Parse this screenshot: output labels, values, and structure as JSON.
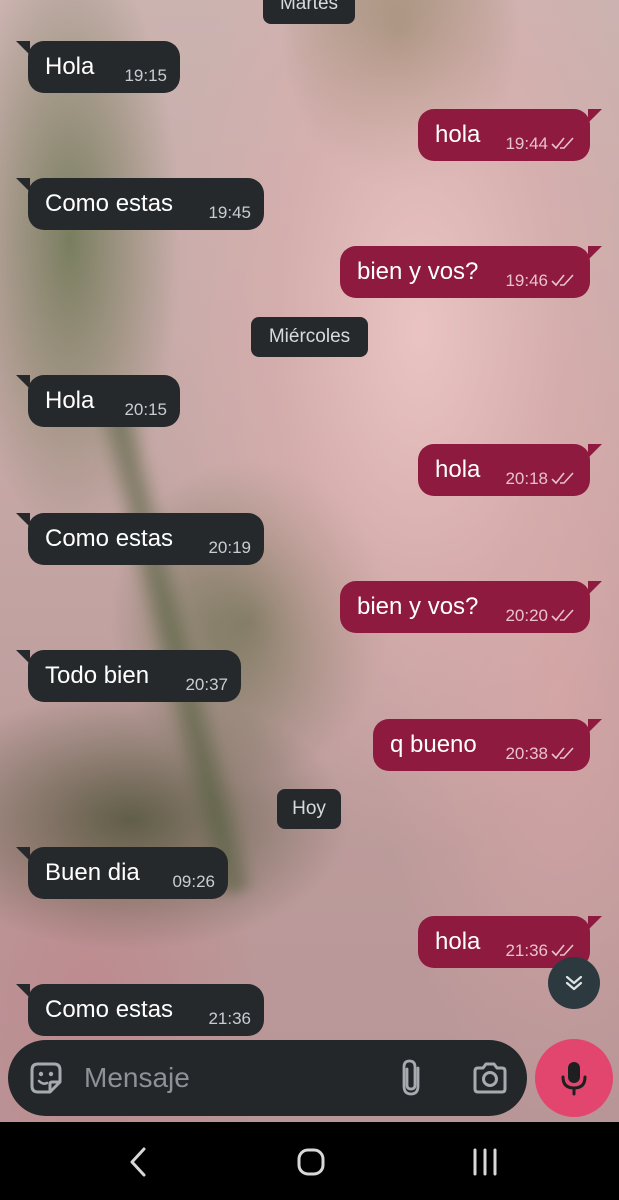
{
  "day_separators": {
    "top": "Martes",
    "second": "Miércoles",
    "third": "Hoy"
  },
  "messages": [
    {
      "dir": "in",
      "text": "Hola",
      "time": "19:15"
    },
    {
      "dir": "out",
      "text": "hola",
      "time": "19:44",
      "status": "read"
    },
    {
      "dir": "in",
      "text": "Como estas",
      "time": "19:45"
    },
    {
      "dir": "out",
      "text": "bien y vos?",
      "time": "19:46",
      "status": "read"
    },
    {
      "dir": "in",
      "text": "Hola",
      "time": "20:15"
    },
    {
      "dir": "out",
      "text": "hola",
      "time": "20:18",
      "status": "read"
    },
    {
      "dir": "in",
      "text": "Como estas",
      "time": "20:19"
    },
    {
      "dir": "out",
      "text": "bien y vos?",
      "time": "20:20",
      "status": "read"
    },
    {
      "dir": "in",
      "text": "Todo bien",
      "time": "20:37"
    },
    {
      "dir": "out",
      "text": "q bueno",
      "time": "20:38",
      "status": "read"
    },
    {
      "dir": "in",
      "text": "Buen dia",
      "time": "09:26"
    },
    {
      "dir": "out",
      "text": "hola",
      "time": "21:36",
      "status": "read"
    },
    {
      "dir": "in",
      "text": "Como estas",
      "time": "21:36"
    }
  ],
  "composer": {
    "placeholder": "Mensaje",
    "icons": [
      "sticker-icon",
      "attach-icon",
      "camera-icon",
      "mic-icon"
    ]
  },
  "scroll_down_icon": "double-chevron-down-icon",
  "navigation_bar": [
    "back-icon",
    "home-icon",
    "recents-icon"
  ],
  "colors": {
    "incoming_bubble": "#26292c",
    "outgoing_bubble": "#8e1a3f",
    "mic_button": "#e2466e",
    "composer_background": "#23272a"
  }
}
